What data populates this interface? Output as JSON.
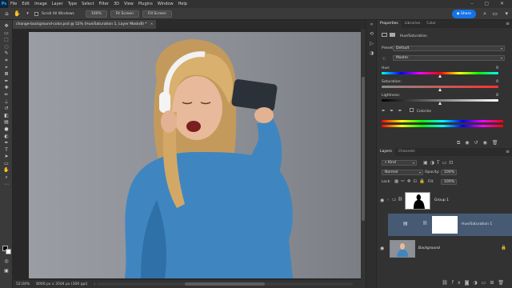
{
  "menu": {
    "logo": "Ps",
    "items": [
      "File",
      "Edit",
      "Image",
      "Layer",
      "Type",
      "Select",
      "Filter",
      "3D",
      "View",
      "Plugins",
      "Window",
      "Help"
    ]
  },
  "options_bar": {
    "scroll_all_label": "Scroll All Windows",
    "zoom_100_label": "100%",
    "fit_screen_label": "Fit Screen",
    "fill_screen_label": "Fill Screen",
    "share_label": "Share"
  },
  "document": {
    "tab_title": "change-background-color.psd @ 52% (Hue/Saturation 1, Layer Mask/8) *",
    "close_glyph": "×"
  },
  "status": {
    "zoom": "52.04%",
    "dimensions": "8000 px x 3504 px (300 ppi)",
    "arrow": "›"
  },
  "properties": {
    "tabs": [
      "Properties",
      "Libraries",
      "Color"
    ],
    "adjustment_title": "Hue/Saturation",
    "preset_label": "Preset:",
    "preset_value": "Default",
    "channel_value": "Master",
    "hue_label": "Hue:",
    "hue_value": "0",
    "saturation_label": "Saturation:",
    "saturation_value": "0",
    "lightness_label": "Lightness:",
    "lightness_value": "0",
    "colorize_label": "Colorize"
  },
  "layers": {
    "tabs": [
      "Layers",
      "Channels"
    ],
    "kind_label": "Kind",
    "blend_mode": "Normal",
    "opacity_label": "Opacity:",
    "opacity_value": "100%",
    "lock_label": "Lock:",
    "fill_label": "Fill:",
    "fill_value": "100%",
    "items": [
      {
        "name": "Group 1"
      },
      {
        "name": "Hue/Saturation 1"
      },
      {
        "name": "Background"
      }
    ]
  },
  "colors": {
    "accent": "#1473e6",
    "selected_layer": "#465a74",
    "panel_bg": "#323232"
  }
}
